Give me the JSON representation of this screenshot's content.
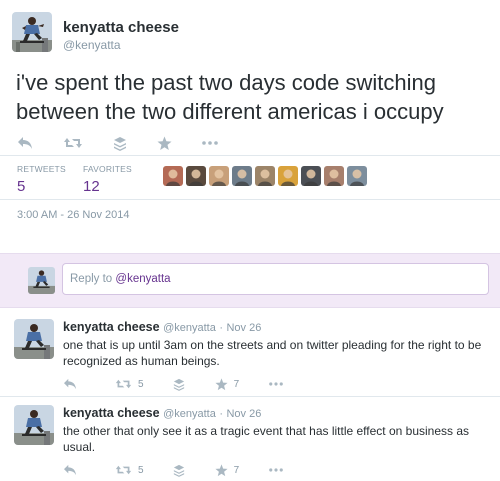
{
  "tweet": {
    "author_name": "kenyatta cheese",
    "author_handle": "@kenyatta",
    "text": "i've spent the past two days code switching between the two different americas i occupy",
    "actions": [
      "reply-icon",
      "retweet-icon",
      "stack-icon",
      "star-icon",
      "more-icon"
    ],
    "stats": {
      "retweets_label": "RETWEETS",
      "retweets_value": "5",
      "favorites_label": "FAVORITES",
      "favorites_value": "12"
    },
    "favoriter_avatar_colors": [
      "#b46a55",
      "#5a4a3e",
      "#c8a07a",
      "#6d7c8a",
      "#9c8468",
      "#d9a23b",
      "#4b4f55",
      "#a77f6c",
      "#7d8e9d"
    ],
    "timestamp": "3:00 AM - 26 Nov 2014"
  },
  "reply_box": {
    "prefix": "Reply to ",
    "mention": "@kenyatta"
  },
  "replies": [
    {
      "name": "kenyatta cheese",
      "handle": "@kenyatta",
      "dot": "·",
      "date": "Nov 26",
      "text": "one that is up until 3am on the streets and on twitter pleading for the right to be recognized as human beings.",
      "retweets": "5",
      "favorites": "7"
    },
    {
      "name": "kenyatta cheese",
      "handle": "@kenyatta",
      "dot": "·",
      "date": "Nov 26",
      "text": "the other that only see it as a tragic event that has little effect on business as usual.",
      "retweets": "5",
      "favorites": "7"
    }
  ],
  "colors": {
    "accent": "#66338f",
    "muted": "#8899a6",
    "icon": "#aab8c2",
    "reply_bar_bg": "#f2e9f7"
  }
}
